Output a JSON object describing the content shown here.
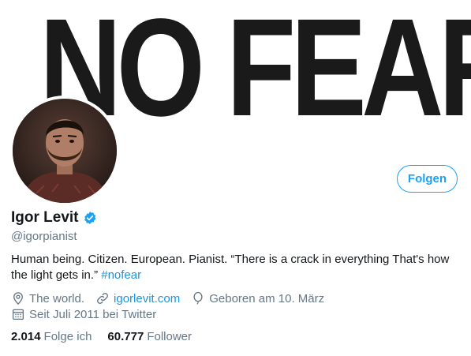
{
  "banner": {
    "text": "NO FEAR"
  },
  "profile": {
    "name": "Igor Levit",
    "handle": "@igorpianist",
    "follow_label": "Folgen",
    "bio_text": "Human being. Citizen. European. Pianist. “There is a crack in everything That's how the light gets in.” ",
    "bio_hashtag": "#nofear",
    "location": "The world.",
    "website": "igorlevit.com",
    "birthday": "Geboren am 10. März",
    "joined": "Seit Juli 2011 bei Twitter"
  },
  "stats": {
    "following_count": "2.014",
    "following_label": "Folge ich",
    "followers_count": "60.777",
    "followers_label": "Follower"
  },
  "colors": {
    "accent": "#1da1f2",
    "link": "#1b95e0",
    "muted": "#657786",
    "text": "#14171a"
  },
  "icons": [
    "verified-badge-icon",
    "location-pin-icon",
    "link-icon",
    "balloon-icon",
    "calendar-icon"
  ]
}
